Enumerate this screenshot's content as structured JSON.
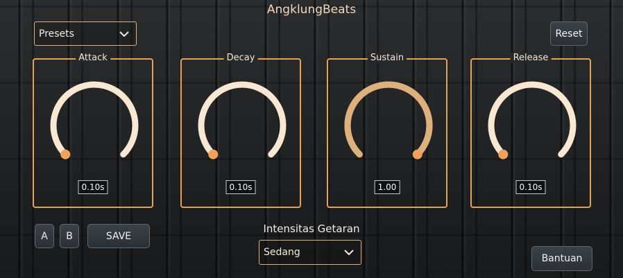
{
  "app": {
    "title": "AngklungBeats"
  },
  "presets": {
    "value": "Presets"
  },
  "reset": {
    "label": "Reset"
  },
  "knobs": [
    {
      "label": "Attack",
      "value": "0.10s",
      "level": 0.0
    },
    {
      "label": "Decay",
      "value": "0.10s",
      "level": 0.0
    },
    {
      "label": "Sustain",
      "value": "1.00",
      "level": 1.0
    },
    {
      "label": "Release",
      "value": "0.10s",
      "level": 0.0
    }
  ],
  "bottom": {
    "a_label": "A",
    "b_label": "B",
    "save_label": "SAVE",
    "intensity_label": "Intensitas Getaran",
    "intensity_value": "Sedang",
    "help_label": "Bantuan"
  },
  "colors": {
    "accent": "#e8a158",
    "knob_track": "#f8e7d2",
    "knob_fill": "#ddb07c",
    "knob_dot": "#f2a15a"
  },
  "icons": {
    "chevron": "chevron-down-icon"
  }
}
